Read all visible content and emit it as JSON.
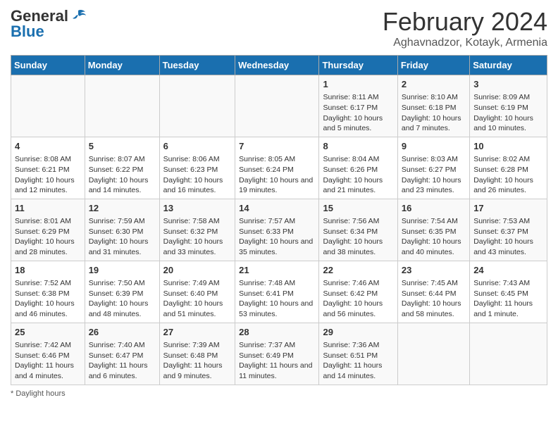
{
  "header": {
    "logo_line1": "General",
    "logo_line2": "Blue",
    "title": "February 2024",
    "subtitle": "Aghavnadzor, Kotayk, Armenia"
  },
  "days_of_week": [
    "Sunday",
    "Monday",
    "Tuesday",
    "Wednesday",
    "Thursday",
    "Friday",
    "Saturday"
  ],
  "weeks": [
    [
      {
        "day": "",
        "info": ""
      },
      {
        "day": "",
        "info": ""
      },
      {
        "day": "",
        "info": ""
      },
      {
        "day": "",
        "info": ""
      },
      {
        "day": "1",
        "info": "Sunrise: 8:11 AM\nSunset: 6:17 PM\nDaylight: 10 hours and 5 minutes."
      },
      {
        "day": "2",
        "info": "Sunrise: 8:10 AM\nSunset: 6:18 PM\nDaylight: 10 hours and 7 minutes."
      },
      {
        "day": "3",
        "info": "Sunrise: 8:09 AM\nSunset: 6:19 PM\nDaylight: 10 hours and 10 minutes."
      }
    ],
    [
      {
        "day": "4",
        "info": "Sunrise: 8:08 AM\nSunset: 6:21 PM\nDaylight: 10 hours and 12 minutes."
      },
      {
        "day": "5",
        "info": "Sunrise: 8:07 AM\nSunset: 6:22 PM\nDaylight: 10 hours and 14 minutes."
      },
      {
        "day": "6",
        "info": "Sunrise: 8:06 AM\nSunset: 6:23 PM\nDaylight: 10 hours and 16 minutes."
      },
      {
        "day": "7",
        "info": "Sunrise: 8:05 AM\nSunset: 6:24 PM\nDaylight: 10 hours and 19 minutes."
      },
      {
        "day": "8",
        "info": "Sunrise: 8:04 AM\nSunset: 6:26 PM\nDaylight: 10 hours and 21 minutes."
      },
      {
        "day": "9",
        "info": "Sunrise: 8:03 AM\nSunset: 6:27 PM\nDaylight: 10 hours and 23 minutes."
      },
      {
        "day": "10",
        "info": "Sunrise: 8:02 AM\nSunset: 6:28 PM\nDaylight: 10 hours and 26 minutes."
      }
    ],
    [
      {
        "day": "11",
        "info": "Sunrise: 8:01 AM\nSunset: 6:29 PM\nDaylight: 10 hours and 28 minutes."
      },
      {
        "day": "12",
        "info": "Sunrise: 7:59 AM\nSunset: 6:30 PM\nDaylight: 10 hours and 31 minutes."
      },
      {
        "day": "13",
        "info": "Sunrise: 7:58 AM\nSunset: 6:32 PM\nDaylight: 10 hours and 33 minutes."
      },
      {
        "day": "14",
        "info": "Sunrise: 7:57 AM\nSunset: 6:33 PM\nDaylight: 10 hours and 35 minutes."
      },
      {
        "day": "15",
        "info": "Sunrise: 7:56 AM\nSunset: 6:34 PM\nDaylight: 10 hours and 38 minutes."
      },
      {
        "day": "16",
        "info": "Sunrise: 7:54 AM\nSunset: 6:35 PM\nDaylight: 10 hours and 40 minutes."
      },
      {
        "day": "17",
        "info": "Sunrise: 7:53 AM\nSunset: 6:37 PM\nDaylight: 10 hours and 43 minutes."
      }
    ],
    [
      {
        "day": "18",
        "info": "Sunrise: 7:52 AM\nSunset: 6:38 PM\nDaylight: 10 hours and 46 minutes."
      },
      {
        "day": "19",
        "info": "Sunrise: 7:50 AM\nSunset: 6:39 PM\nDaylight: 10 hours and 48 minutes."
      },
      {
        "day": "20",
        "info": "Sunrise: 7:49 AM\nSunset: 6:40 PM\nDaylight: 10 hours and 51 minutes."
      },
      {
        "day": "21",
        "info": "Sunrise: 7:48 AM\nSunset: 6:41 PM\nDaylight: 10 hours and 53 minutes."
      },
      {
        "day": "22",
        "info": "Sunrise: 7:46 AM\nSunset: 6:42 PM\nDaylight: 10 hours and 56 minutes."
      },
      {
        "day": "23",
        "info": "Sunrise: 7:45 AM\nSunset: 6:44 PM\nDaylight: 10 hours and 58 minutes."
      },
      {
        "day": "24",
        "info": "Sunrise: 7:43 AM\nSunset: 6:45 PM\nDaylight: 11 hours and 1 minute."
      }
    ],
    [
      {
        "day": "25",
        "info": "Sunrise: 7:42 AM\nSunset: 6:46 PM\nDaylight: 11 hours and 4 minutes."
      },
      {
        "day": "26",
        "info": "Sunrise: 7:40 AM\nSunset: 6:47 PM\nDaylight: 11 hours and 6 minutes."
      },
      {
        "day": "27",
        "info": "Sunrise: 7:39 AM\nSunset: 6:48 PM\nDaylight: 11 hours and 9 minutes."
      },
      {
        "day": "28",
        "info": "Sunrise: 7:37 AM\nSunset: 6:49 PM\nDaylight: 11 hours and 11 minutes."
      },
      {
        "day": "29",
        "info": "Sunrise: 7:36 AM\nSunset: 6:51 PM\nDaylight: 11 hours and 14 minutes."
      },
      {
        "day": "",
        "info": ""
      },
      {
        "day": "",
        "info": ""
      }
    ]
  ],
  "footer": {
    "note": "Daylight hours"
  }
}
